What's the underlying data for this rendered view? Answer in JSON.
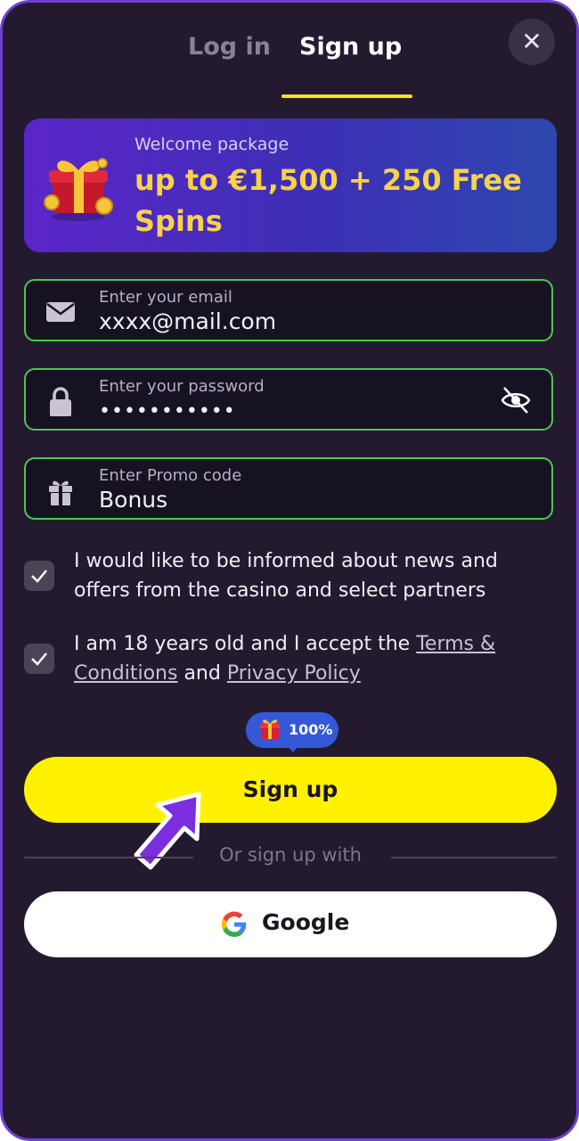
{
  "tabs": {
    "login": "Log in",
    "signup": "Sign up"
  },
  "close": {
    "glyph": "✕"
  },
  "promo": {
    "label": "Welcome package",
    "title": "up to €1,500 + 250 Free Spins"
  },
  "form": {
    "email": {
      "label": "Enter your email",
      "value": "xxxx@mail.com",
      "icon": "envelope-icon"
    },
    "password": {
      "label": "Enter your password",
      "value": "•••••••••••",
      "icon": "lock-icon",
      "toggle_icon": "eye-slash-icon"
    },
    "promo_code": {
      "label": "Enter Promo code",
      "value": "Bonus",
      "icon": "gift-icon"
    }
  },
  "consents": {
    "news": {
      "checked": true,
      "text": "I would like to be informed about news and offers from the casino and select partners"
    },
    "age": {
      "checked": true,
      "text_before": "I am 18 years old and I accept the ",
      "terms_link": "Terms & Conditions",
      "text_middle": " and ",
      "privacy_link": "Privacy Policy"
    }
  },
  "bonus_badge": {
    "text": "100%"
  },
  "signup_button": {
    "label": "Sign up"
  },
  "divider": {
    "text": "Or sign up with"
  },
  "google_button": {
    "label": "Google"
  },
  "colors": {
    "background": "#241a2f",
    "accent_yellow": "#fff200",
    "field_border": "#49c94f",
    "promo_text": "#f7d24a",
    "badge_blue": "#3559d6",
    "frame_border": "#6d3fd4"
  }
}
